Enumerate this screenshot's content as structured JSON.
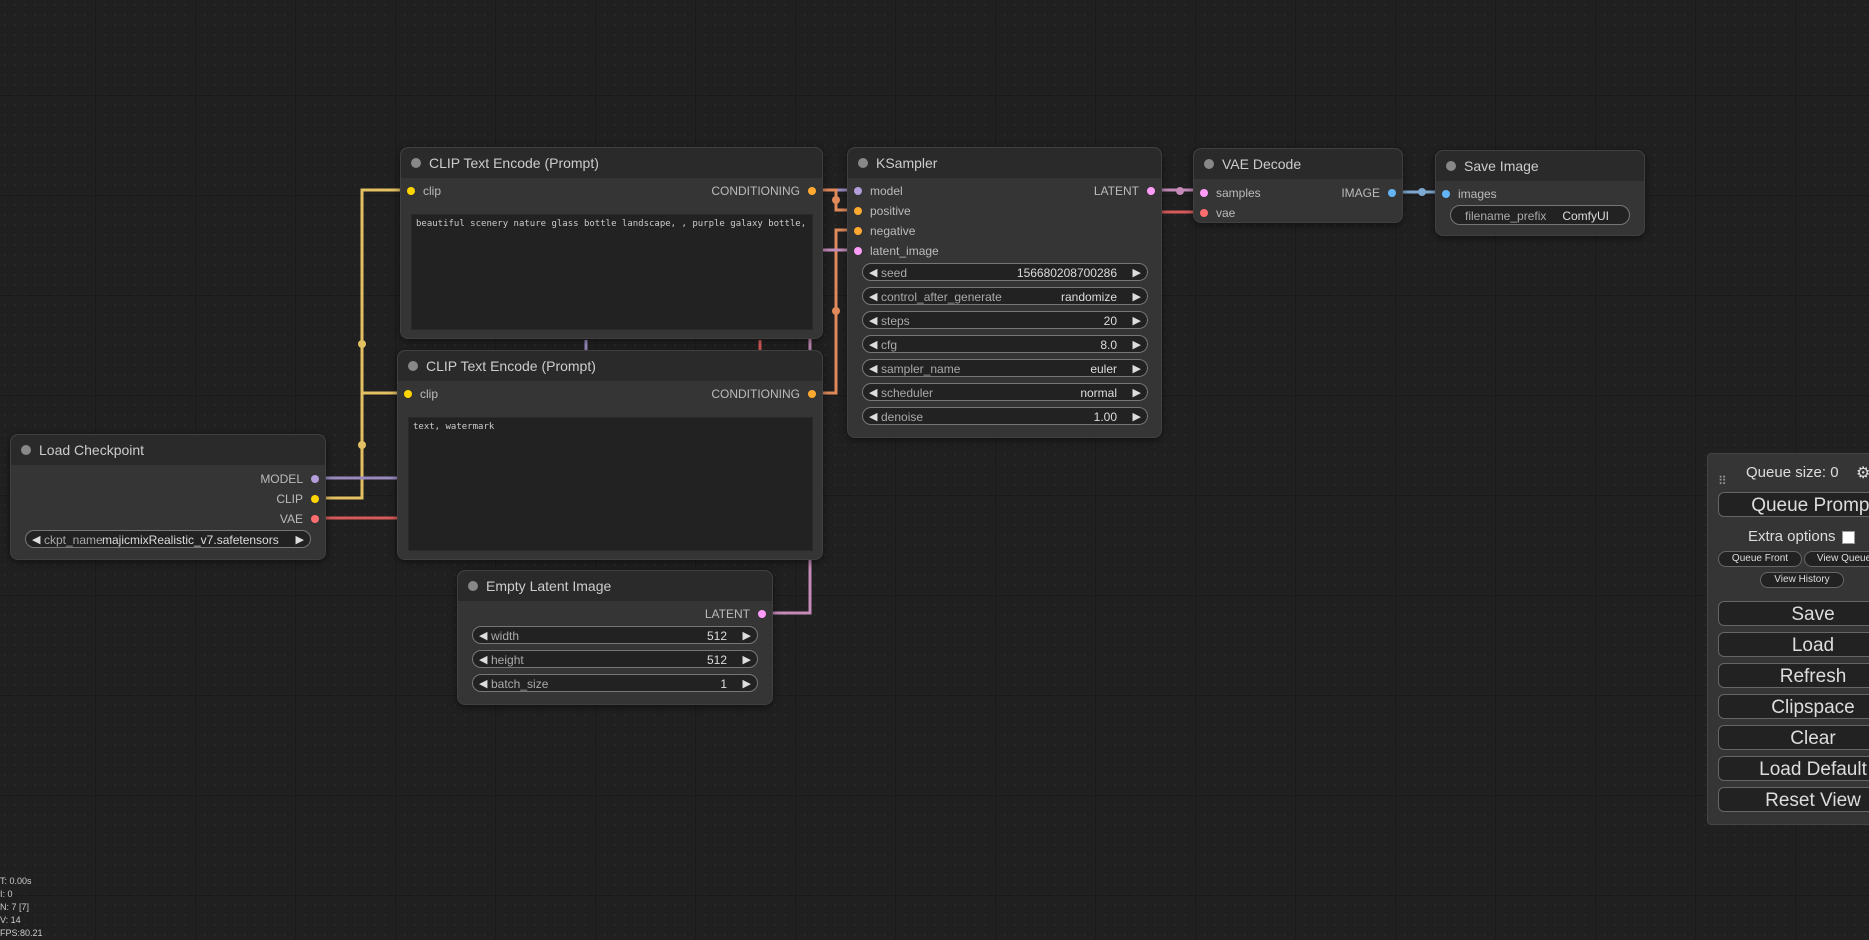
{
  "nodes": {
    "clip_pos": {
      "title": "CLIP Text Encode (Prompt)",
      "input_clip": "clip",
      "output": "CONDITIONING",
      "text": "beautiful scenery nature glass bottle landscape, , purple galaxy bottle,"
    },
    "clip_neg": {
      "title": "CLIP Text Encode (Prompt)",
      "input_clip": "clip",
      "output": "CONDITIONING",
      "text": "text, watermark"
    },
    "ksampler": {
      "title": "KSampler",
      "inputs": [
        "model",
        "positive",
        "negative",
        "latent_image"
      ],
      "output": "LATENT",
      "widgets": [
        {
          "label": "seed",
          "value": "156680208700286"
        },
        {
          "label": "control_after_generate",
          "value": "randomize"
        },
        {
          "label": "steps",
          "value": "20"
        },
        {
          "label": "cfg",
          "value": "8.0"
        },
        {
          "label": "sampler_name",
          "value": "euler"
        },
        {
          "label": "scheduler",
          "value": "normal"
        },
        {
          "label": "denoise",
          "value": "1.00"
        }
      ]
    },
    "vae_decode": {
      "title": "VAE Decode",
      "inputs": [
        "samples",
        "vae"
      ],
      "output": "IMAGE"
    },
    "save_image": {
      "title": "Save Image",
      "input": "images",
      "widget_label": "filename_prefix",
      "widget_value": "ComfyUI"
    },
    "load_checkpoint": {
      "title": "Load Checkpoint",
      "outputs": [
        "MODEL",
        "CLIP",
        "VAE"
      ],
      "widget_label": "ckpt_name",
      "widget_value": "majicmixRealistic_v7.safetensors"
    },
    "empty_latent": {
      "title": "Empty Latent Image",
      "output": "LATENT",
      "widgets": [
        {
          "label": "width",
          "value": "512"
        },
        {
          "label": "height",
          "value": "512"
        },
        {
          "label": "batch_size",
          "value": "1"
        }
      ]
    }
  },
  "menu": {
    "queue_size": "Queue size: 0",
    "queue_prompt": "Queue Prompt",
    "extra_options": "Extra options",
    "queue_front": "Queue Front",
    "view_queue": "View Queue",
    "view_history": "View History",
    "buttons": [
      "Save",
      "Load",
      "Refresh",
      "Clipspace",
      "Clear",
      "Load Default",
      "Reset View"
    ]
  },
  "stats": [
    "T: 0.00s",
    "I: 0",
    "N: 7 [7]",
    "V: 14",
    "FPS:80.21"
  ],
  "colors": {
    "clip": "#FFD500",
    "model": "#B39DDB",
    "vae": "#FF6E6E",
    "latent": "#FF9CF9",
    "conditioning": "#FFA931",
    "image": "#64B5F6"
  }
}
